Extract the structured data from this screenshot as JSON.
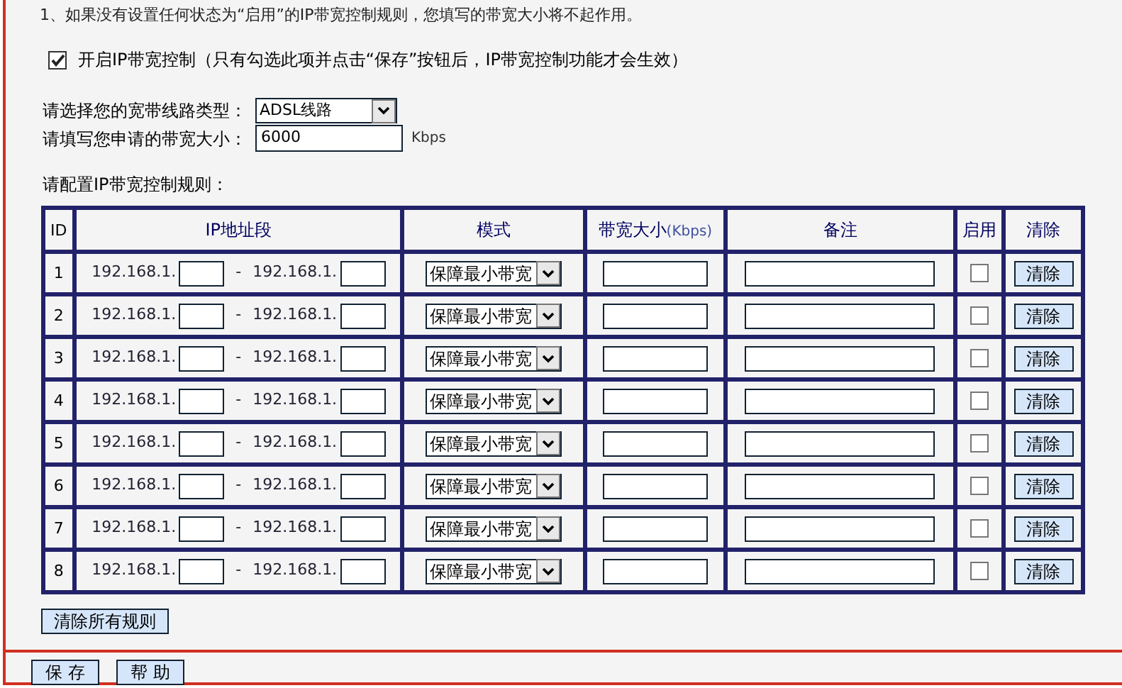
{
  "note": "1、如果没有设置任何状态为“启用”的IP带宽控制规则，您填写的带宽大小将不起作用。",
  "enable": {
    "label": "开启IP带宽控制（只有勾选此项并点击“保存”按钮后，IP带宽控制功能才会生效）",
    "checked": true
  },
  "line_type": {
    "label": "请选择您的宽带线路类型：",
    "value": "ADSL线路"
  },
  "bandwidth": {
    "label": "请填写您申请的带宽大小：",
    "value": "6000",
    "unit": "Kbps"
  },
  "rules_title": "请配置IP带宽控制规则：",
  "table": {
    "columns": [
      {
        "label": "ID"
      },
      {
        "label": "IP地址段"
      },
      {
        "label": "模式"
      },
      {
        "label": "带宽大小",
        "unit": "(Kbps)"
      },
      {
        "label": "备注"
      },
      {
        "label": "启用"
      },
      {
        "label": "清除"
      }
    ],
    "rows": [
      {
        "id": "1",
        "ip_start": "192.168.1.",
        "separator": "-",
        "ip_end": "192.168.1.",
        "mode": "保障最小带宽",
        "enabled": false,
        "clear": "清除"
      },
      {
        "id": "2",
        "ip_start": "192.168.1.",
        "separator": "-",
        "ip_end": "192.168.1.",
        "mode": "保障最小带宽",
        "enabled": false,
        "clear": "清除"
      },
      {
        "id": "3",
        "ip_start": "192.168.1.",
        "separator": "-",
        "ip_end": "192.168.1.",
        "mode": "保障最小带宽",
        "enabled": false,
        "clear": "清除"
      },
      {
        "id": "4",
        "ip_start": "192.168.1.",
        "separator": "-",
        "ip_end": "192.168.1.",
        "mode": "保障最小带宽",
        "enabled": false,
        "clear": "清除"
      },
      {
        "id": "5",
        "ip_start": "192.168.1.",
        "separator": "-",
        "ip_end": "192.168.1.",
        "mode": "保障最小带宽",
        "enabled": false,
        "clear": "清除"
      },
      {
        "id": "6",
        "ip_start": "192.168.1.",
        "separator": "-",
        "ip_end": "192.168.1.",
        "mode": "保障最小带宽",
        "enabled": false,
        "clear": "清除"
      },
      {
        "id": "7",
        "ip_start": "192.168.1.",
        "separator": "-",
        "ip_end": "192.168.1.",
        "mode": "保障最小带宽",
        "enabled": false,
        "clear": "清除"
      },
      {
        "id": "8",
        "ip_start": "192.168.1.",
        "separator": "-",
        "ip_end": "192.168.1.",
        "mode": "保障最小带宽",
        "enabled": false,
        "clear": "清除"
      }
    ]
  },
  "clear_all_button": "清除所有规则",
  "buttons": [
    "保 存",
    "帮 助"
  ]
}
